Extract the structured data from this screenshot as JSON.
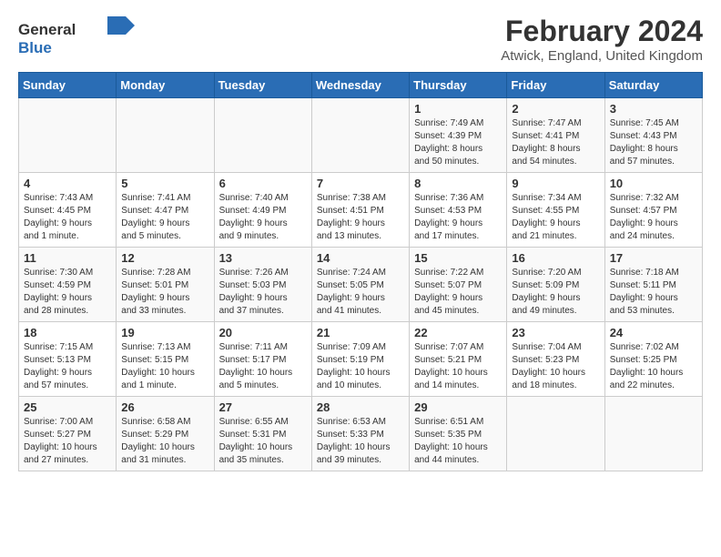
{
  "logo": {
    "line1": "General",
    "line2": "Blue"
  },
  "title": "February 2024",
  "subtitle": "Atwick, England, United Kingdom",
  "days_of_week": [
    "Sunday",
    "Monday",
    "Tuesday",
    "Wednesday",
    "Thursday",
    "Friday",
    "Saturday"
  ],
  "weeks": [
    [
      {
        "day": "",
        "info": ""
      },
      {
        "day": "",
        "info": ""
      },
      {
        "day": "",
        "info": ""
      },
      {
        "day": "",
        "info": ""
      },
      {
        "day": "1",
        "info": "Sunrise: 7:49 AM\nSunset: 4:39 PM\nDaylight: 8 hours\nand 50 minutes."
      },
      {
        "day": "2",
        "info": "Sunrise: 7:47 AM\nSunset: 4:41 PM\nDaylight: 8 hours\nand 54 minutes."
      },
      {
        "day": "3",
        "info": "Sunrise: 7:45 AM\nSunset: 4:43 PM\nDaylight: 8 hours\nand 57 minutes."
      }
    ],
    [
      {
        "day": "4",
        "info": "Sunrise: 7:43 AM\nSunset: 4:45 PM\nDaylight: 9 hours\nand 1 minute."
      },
      {
        "day": "5",
        "info": "Sunrise: 7:41 AM\nSunset: 4:47 PM\nDaylight: 9 hours\nand 5 minutes."
      },
      {
        "day": "6",
        "info": "Sunrise: 7:40 AM\nSunset: 4:49 PM\nDaylight: 9 hours\nand 9 minutes."
      },
      {
        "day": "7",
        "info": "Sunrise: 7:38 AM\nSunset: 4:51 PM\nDaylight: 9 hours\nand 13 minutes."
      },
      {
        "day": "8",
        "info": "Sunrise: 7:36 AM\nSunset: 4:53 PM\nDaylight: 9 hours\nand 17 minutes."
      },
      {
        "day": "9",
        "info": "Sunrise: 7:34 AM\nSunset: 4:55 PM\nDaylight: 9 hours\nand 21 minutes."
      },
      {
        "day": "10",
        "info": "Sunrise: 7:32 AM\nSunset: 4:57 PM\nDaylight: 9 hours\nand 24 minutes."
      }
    ],
    [
      {
        "day": "11",
        "info": "Sunrise: 7:30 AM\nSunset: 4:59 PM\nDaylight: 9 hours\nand 28 minutes."
      },
      {
        "day": "12",
        "info": "Sunrise: 7:28 AM\nSunset: 5:01 PM\nDaylight: 9 hours\nand 33 minutes."
      },
      {
        "day": "13",
        "info": "Sunrise: 7:26 AM\nSunset: 5:03 PM\nDaylight: 9 hours\nand 37 minutes."
      },
      {
        "day": "14",
        "info": "Sunrise: 7:24 AM\nSunset: 5:05 PM\nDaylight: 9 hours\nand 41 minutes."
      },
      {
        "day": "15",
        "info": "Sunrise: 7:22 AM\nSunset: 5:07 PM\nDaylight: 9 hours\nand 45 minutes."
      },
      {
        "day": "16",
        "info": "Sunrise: 7:20 AM\nSunset: 5:09 PM\nDaylight: 9 hours\nand 49 minutes."
      },
      {
        "day": "17",
        "info": "Sunrise: 7:18 AM\nSunset: 5:11 PM\nDaylight: 9 hours\nand 53 minutes."
      }
    ],
    [
      {
        "day": "18",
        "info": "Sunrise: 7:15 AM\nSunset: 5:13 PM\nDaylight: 9 hours\nand 57 minutes."
      },
      {
        "day": "19",
        "info": "Sunrise: 7:13 AM\nSunset: 5:15 PM\nDaylight: 10 hours\nand 1 minute."
      },
      {
        "day": "20",
        "info": "Sunrise: 7:11 AM\nSunset: 5:17 PM\nDaylight: 10 hours\nand 5 minutes."
      },
      {
        "day": "21",
        "info": "Sunrise: 7:09 AM\nSunset: 5:19 PM\nDaylight: 10 hours\nand 10 minutes."
      },
      {
        "day": "22",
        "info": "Sunrise: 7:07 AM\nSunset: 5:21 PM\nDaylight: 10 hours\nand 14 minutes."
      },
      {
        "day": "23",
        "info": "Sunrise: 7:04 AM\nSunset: 5:23 PM\nDaylight: 10 hours\nand 18 minutes."
      },
      {
        "day": "24",
        "info": "Sunrise: 7:02 AM\nSunset: 5:25 PM\nDaylight: 10 hours\nand 22 minutes."
      }
    ],
    [
      {
        "day": "25",
        "info": "Sunrise: 7:00 AM\nSunset: 5:27 PM\nDaylight: 10 hours\nand 27 minutes."
      },
      {
        "day": "26",
        "info": "Sunrise: 6:58 AM\nSunset: 5:29 PM\nDaylight: 10 hours\nand 31 minutes."
      },
      {
        "day": "27",
        "info": "Sunrise: 6:55 AM\nSunset: 5:31 PM\nDaylight: 10 hours\nand 35 minutes."
      },
      {
        "day": "28",
        "info": "Sunrise: 6:53 AM\nSunset: 5:33 PM\nDaylight: 10 hours\nand 39 minutes."
      },
      {
        "day": "29",
        "info": "Sunrise: 6:51 AM\nSunset: 5:35 PM\nDaylight: 10 hours\nand 44 minutes."
      },
      {
        "day": "",
        "info": ""
      },
      {
        "day": "",
        "info": ""
      }
    ]
  ]
}
